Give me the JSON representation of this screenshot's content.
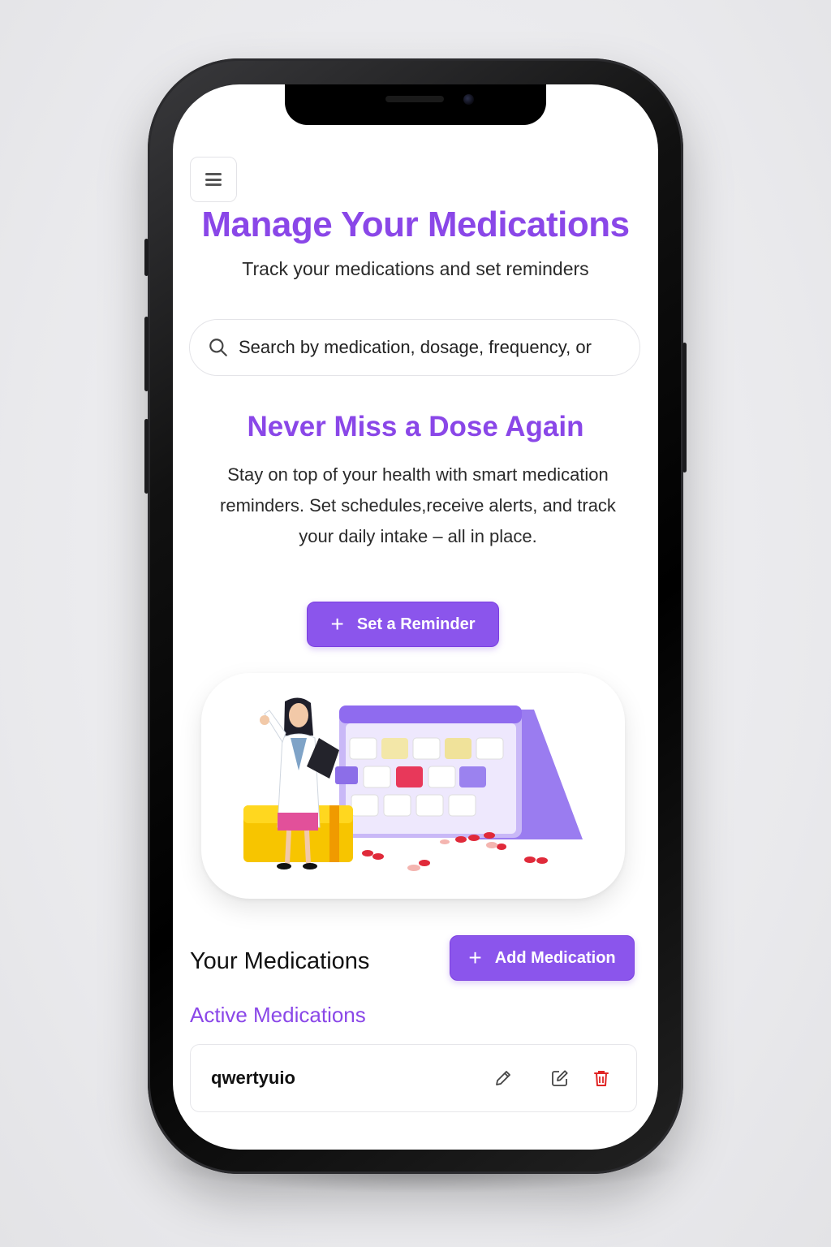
{
  "header": {
    "title": "Manage Your Medications",
    "subtitle": "Track your medications and set reminders"
  },
  "search": {
    "placeholder": "Search by medication, dosage, frequency, or"
  },
  "hero": {
    "title": "Never Miss a Dose Again",
    "text": "Stay on top of your health with smart medication reminders. Set schedules,receive alerts, and track your daily intake – all in place.",
    "button_label": "Set a Reminder"
  },
  "medications": {
    "section_title": "Your Medications",
    "add_button_label": "Add Medication",
    "active_title": "Active Medications",
    "items": [
      {
        "name": "qwertyuio"
      }
    ]
  },
  "icons": {
    "menu": "menu-icon",
    "search": "search-icon",
    "plus": "plus-icon",
    "pencil": "pencil-icon",
    "edit": "edit-icon",
    "trash": "trash-icon"
  },
  "colors": {
    "accent": "#8a47e8",
    "button": "#8b55ec",
    "danger": "#e02424"
  }
}
